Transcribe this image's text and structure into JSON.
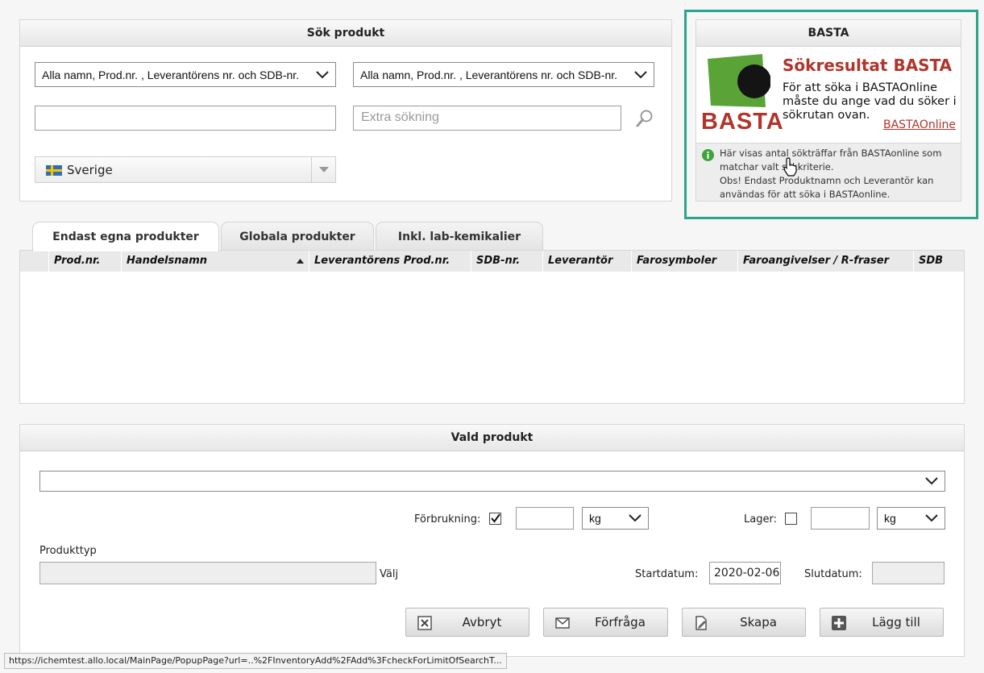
{
  "search": {
    "title": "Sök produkt",
    "select_left": "Alla namn, Prod.nr. , Leverantörens nr. och SDB-nr.",
    "select_right": "Alla namn, Prod.nr. , Leverantörens nr. och SDB-nr.",
    "main_input_value": "",
    "extra_placeholder": "Extra sökning",
    "country": "Sverige"
  },
  "basta": {
    "title": "BASTA",
    "logo_text": "BASTA",
    "heading": "Sökresultat BASTA",
    "description": "För att söka i BASTAOnline måste du ange vad du söker i sökrutan ovan.",
    "link": "BASTAOnline",
    "info_line1": "Här visas antal sökträffar från BASTAonline som matchar valt sökkriterie.",
    "info_line2": "Obs! Endast Produktnamn och Leverantör kan användas för att söka i BASTAonline."
  },
  "tabs": [
    {
      "label": "Endast egna produkter",
      "active": true
    },
    {
      "label": "Globala produkter",
      "active": false
    },
    {
      "label": "Inkl. lab-kemikalier",
      "active": false
    }
  ],
  "table": {
    "columns": [
      "Prod.nr.",
      "Handelsnamn",
      "Leverantörens Prod.nr.",
      "SDB-nr.",
      "Leverantör",
      "Farosymboler",
      "Faroangivelser / R-fraser",
      "SDB"
    ],
    "sorted_column": "Handelsnamn",
    "rows": []
  },
  "selected": {
    "title": "Vald produkt",
    "product_value": "",
    "consumption_label": "Förbrukning:",
    "consumption_checked": true,
    "consumption_value": "",
    "consumption_unit": "kg",
    "stock_label": "Lager:",
    "stock_checked": false,
    "stock_value": "",
    "stock_unit": "kg",
    "product_type_label": "Produkttyp",
    "product_type_value": "",
    "choose_label": "Välj",
    "start_label": "Startdatum:",
    "start_value": "2020-02-06",
    "end_label": "Slutdatum:",
    "end_value": ""
  },
  "buttons": {
    "cancel": "Avbryt",
    "inquiry": "Förfråga",
    "create": "Skapa",
    "add": "Lägg till"
  },
  "status_url": "https://ichemtest.allo.local/MainPage/PopupPage?url=..%2FInventoryAdd%2FAdd%3FcheckForLimitOfSearchT...",
  "colors": {
    "highlight_border": "#2aa58a",
    "basta_red": "#b0352b",
    "basta_green": "#5aa437"
  }
}
